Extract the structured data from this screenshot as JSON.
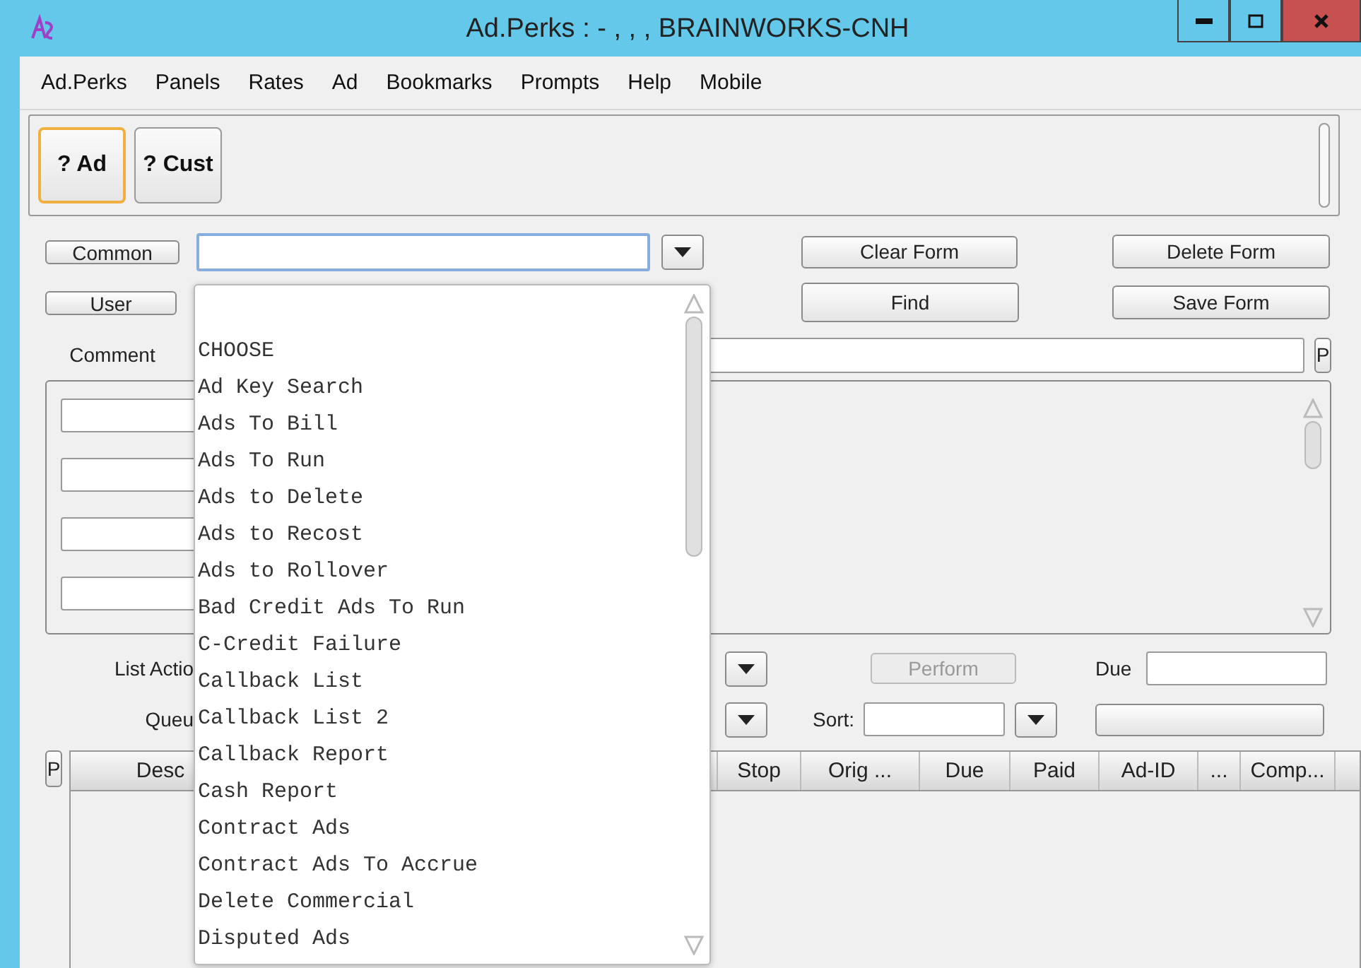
{
  "window": {
    "title": "Ad.Perks : - , , , BRAINWORKS-CNH"
  },
  "menu": [
    "Ad.Perks",
    "Panels",
    "Rates",
    "Ad",
    "Bookmarks",
    "Prompts",
    "Help",
    "Mobile"
  ],
  "toolbar": [
    {
      "label": "? Ad",
      "selected": true
    },
    {
      "label": "? Cust",
      "selected": false
    }
  ],
  "form": {
    "common_button": "Common",
    "user_button": "User",
    "comment_label": "Comment",
    "comment_button": "P",
    "buttons": [
      {
        "label": "Clear Form",
        "disabled": false
      },
      {
        "label": "Delete Form",
        "disabled": false
      },
      {
        "label": "Find",
        "disabled": false
      },
      {
        "label": "Save Form",
        "disabled": false
      }
    ],
    "list_action_label": "List Actio",
    "perform_button": {
      "label": "Perform",
      "disabled": true
    },
    "due_label": "Due",
    "queue_label": "Queu",
    "sort_label": "Sort:"
  },
  "table": {
    "side_button": "P",
    "columns": [
      "Desc",
      "",
      "Stop",
      "Orig ...",
      "Due",
      "Paid",
      "Ad-ID",
      "...",
      "Comp..."
    ]
  },
  "dropdown": {
    "items": [
      "CHOOSE",
      "Ad Key Search",
      "Ads To Bill",
      "Ads To Run",
      "Ads to Delete",
      "Ads to Recost",
      "Ads to Rollover",
      "Bad Credit Ads To Run",
      "C-Credit Failure",
      "Callback List",
      "Callback List 2",
      "Callback Report",
      "Cash Report",
      "Contract Ads",
      "Contract Ads To Accrue",
      "Delete Commercial",
      "Disputed Ads"
    ]
  }
}
